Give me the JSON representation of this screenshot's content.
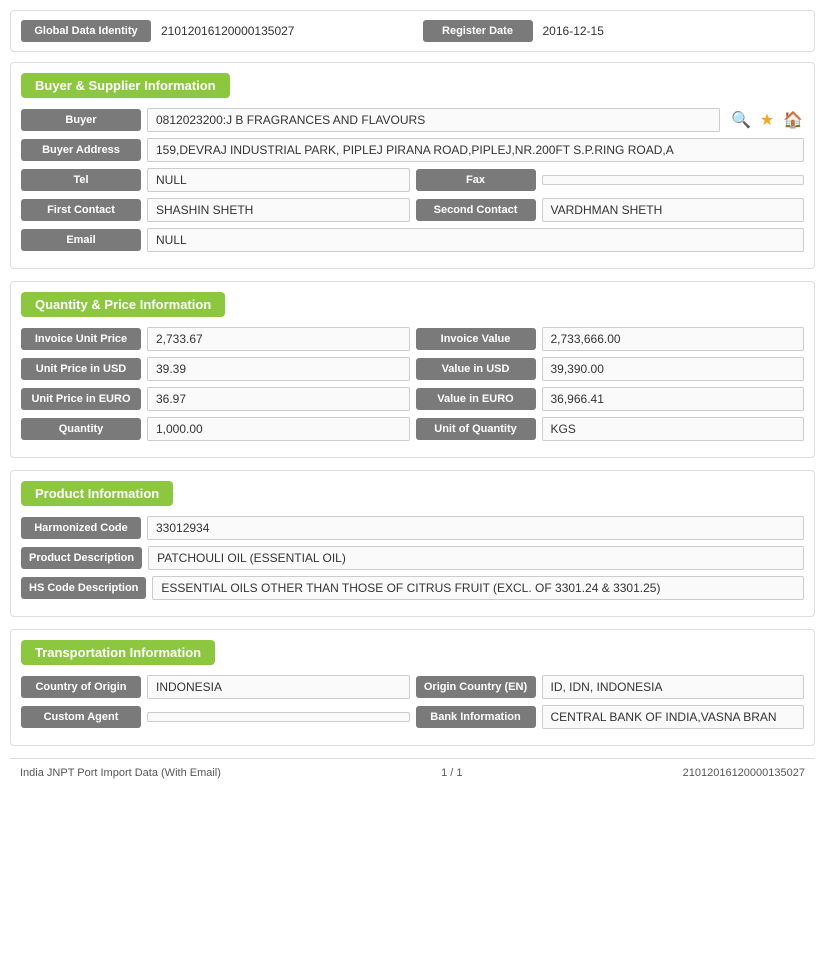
{
  "top": {
    "gdi_label": "Global Data Identity",
    "gdi_value": "21012016120000135027",
    "reg_label": "Register Date",
    "reg_value": "2016-12-15"
  },
  "buyer_supplier": {
    "title": "Buyer & Supplier Information",
    "buyer_label": "Buyer",
    "buyer_value": "0812023200:J B FRAGRANCES AND FLAVOURS",
    "buyer_address_label": "Buyer Address",
    "buyer_address_value": "159,DEVRAJ INDUSTRIAL PARK, PIPLEJ PIRANA ROAD,PIPLEJ,NR.200FT S.P.RING ROAD,A",
    "tel_label": "Tel",
    "tel_value": "NULL",
    "fax_label": "Fax",
    "fax_value": "",
    "first_contact_label": "First Contact",
    "first_contact_value": "SHASHIN SHETH",
    "second_contact_label": "Second Contact",
    "second_contact_value": "VARDHMAN SHETH",
    "email_label": "Email",
    "email_value": "NULL"
  },
  "quantity_price": {
    "title": "Quantity & Price Information",
    "invoice_unit_price_label": "Invoice Unit Price",
    "invoice_unit_price_value": "2,733.67",
    "invoice_value_label": "Invoice Value",
    "invoice_value_value": "2,733,666.00",
    "unit_price_usd_label": "Unit Price in USD",
    "unit_price_usd_value": "39.39",
    "value_usd_label": "Value in USD",
    "value_usd_value": "39,390.00",
    "unit_price_euro_label": "Unit Price in EURO",
    "unit_price_euro_value": "36.97",
    "value_euro_label": "Value in EURO",
    "value_euro_value": "36,966.41",
    "quantity_label": "Quantity",
    "quantity_value": "1,000.00",
    "unit_of_quantity_label": "Unit of Quantity",
    "unit_of_quantity_value": "KGS"
  },
  "product": {
    "title": "Product Information",
    "harmonized_code_label": "Harmonized Code",
    "harmonized_code_value": "33012934",
    "product_description_label": "Product Description",
    "product_description_value": "PATCHOULI OIL (ESSENTIAL OIL)",
    "hs_code_description_label": "HS Code Description",
    "hs_code_description_value": "ESSENTIAL OILS OTHER THAN THOSE OF CITRUS FRUIT (EXCL. OF 3301.24 & 3301.25)"
  },
  "transportation": {
    "title": "Transportation Information",
    "country_of_origin_label": "Country of Origin",
    "country_of_origin_value": "INDONESIA",
    "origin_country_en_label": "Origin Country (EN)",
    "origin_country_en_value": "ID, IDN, INDONESIA",
    "custom_agent_label": "Custom Agent",
    "custom_agent_value": "",
    "bank_information_label": "Bank Information",
    "bank_information_value": "CENTRAL BANK OF INDIA,VASNA BRAN"
  },
  "footer": {
    "left": "India JNPT Port Import Data (With Email)",
    "center": "1 / 1",
    "right": "21012016120000135027"
  }
}
